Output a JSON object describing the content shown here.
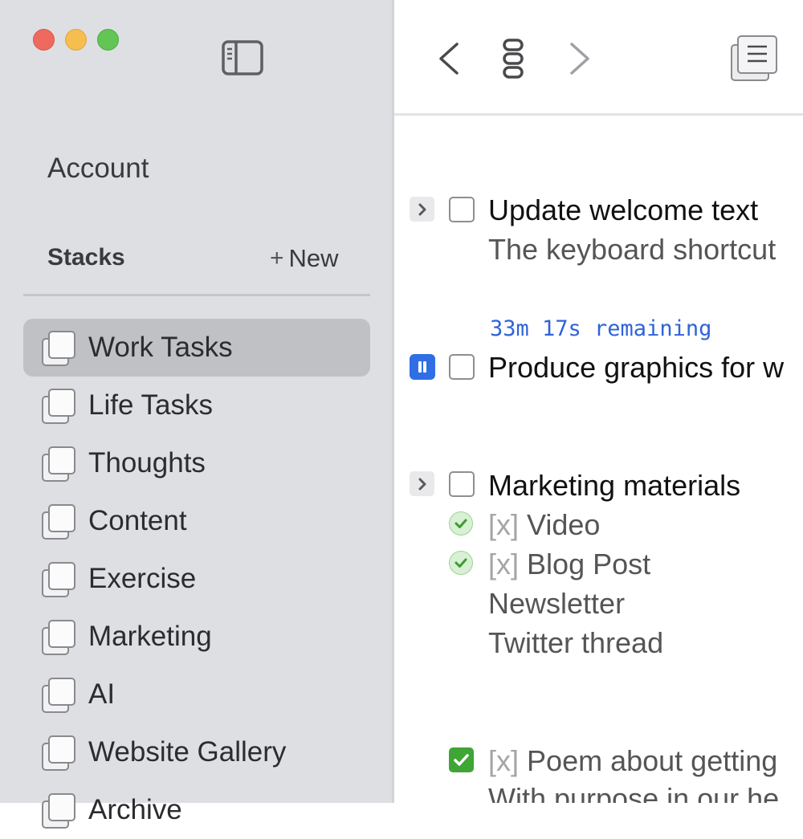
{
  "sidebar": {
    "account_label": "Account",
    "stacks_header": "Stacks",
    "new_button_label": "New",
    "items": [
      {
        "label": "Work Tasks",
        "selected": true
      },
      {
        "label": "Life Tasks"
      },
      {
        "label": "Thoughts"
      },
      {
        "label": "Content"
      },
      {
        "label": "Exercise"
      },
      {
        "label": "Marketing"
      },
      {
        "label": "AI"
      },
      {
        "label": "Website Gallery"
      },
      {
        "label": "Archive"
      }
    ]
  },
  "tasks": {
    "t1": {
      "title": "Update welcome text",
      "subtitle": "The keyboard shortcut"
    },
    "t2": {
      "timer": "33m 17s remaining",
      "title": "Produce graphics for w"
    },
    "t3": {
      "title": "Marketing materials",
      "subitems": [
        {
          "mark": "[x]",
          "text": "Video"
        },
        {
          "mark": "[x]",
          "text": "Blog Post"
        },
        {
          "text": "Newsletter"
        },
        {
          "text": "Twitter thread"
        }
      ]
    },
    "t4": {
      "mark": "[x]",
      "title": "Poem about getting",
      "subtitle": "With purpose in our he"
    }
  },
  "icons": {
    "sidebar_toggle": "sidebar-toggle-icon",
    "back": "chevron-left-icon",
    "board": "board-view-icon",
    "forward": "chevron-right-icon",
    "stack": "stack-list-icon"
  },
  "colors": {
    "accent_blue": "#2f6ee5",
    "timer_blue": "#2f63d8",
    "check_green": "#3fa535",
    "sidebar_bg": "#dedfe3",
    "selected_bg": "#c0c1c5"
  }
}
